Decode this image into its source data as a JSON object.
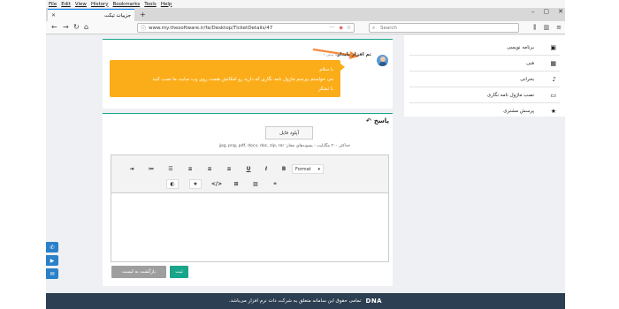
{
  "browser": {
    "menu": [
      "File",
      "Edit",
      "View",
      "History",
      "Bookmarks",
      "Tools",
      "Help"
    ],
    "tab_title": "جزییات تیکت",
    "url": "www.my.thesoftware.ir/fa/Desktop/TicketDetails/47",
    "search_placeholder": "Search"
  },
  "sidebar": {
    "items": [
      {
        "label": "برنامه نویسی",
        "icon": "briefcase-icon"
      },
      {
        "label": "فنی",
        "icon": "server-icon"
      },
      {
        "label": "بحرانی",
        "icon": "music-note-icon"
      },
      {
        "label": "نصب ماژول نامه نگاری",
        "icon": "monitor-icon"
      },
      {
        "label": "پرسش مشتری",
        "icon": "star-icon"
      }
    ]
  },
  "message": {
    "author": "تم افزار پایدار",
    "time": "۱ دقیقه پیش",
    "lines": [
      "با سلام",
      "می خواستم بپرسم ماژول نامه نگاری که دارید رو امکانش هست روی وب سایت ما نصب کنید",
      "با تشکر"
    ],
    "bubble_color": "#fbad19"
  },
  "reply": {
    "title": "پاسخ",
    "upload_label": "آپلود فایل",
    "upload_help": "حداکثر ۲۰۰ مگابایت - پسوندهای مجاز: jpg, png, pdf, docx, doc, zip, rar",
    "format_label": "Format",
    "submit_label": "ثبت",
    "back_label": "بازگشت به لیست"
  },
  "footer": {
    "text": "تمامی حقوق این سامانه متعلق به شرکت دات نرم افزار می‌باشد.",
    "logo": "DNA"
  },
  "colors": {
    "accent": "#18a58a",
    "footer_bg": "#2d3f52",
    "float_buttons": "#2a80c9",
    "arrow": "#f58a3c"
  }
}
